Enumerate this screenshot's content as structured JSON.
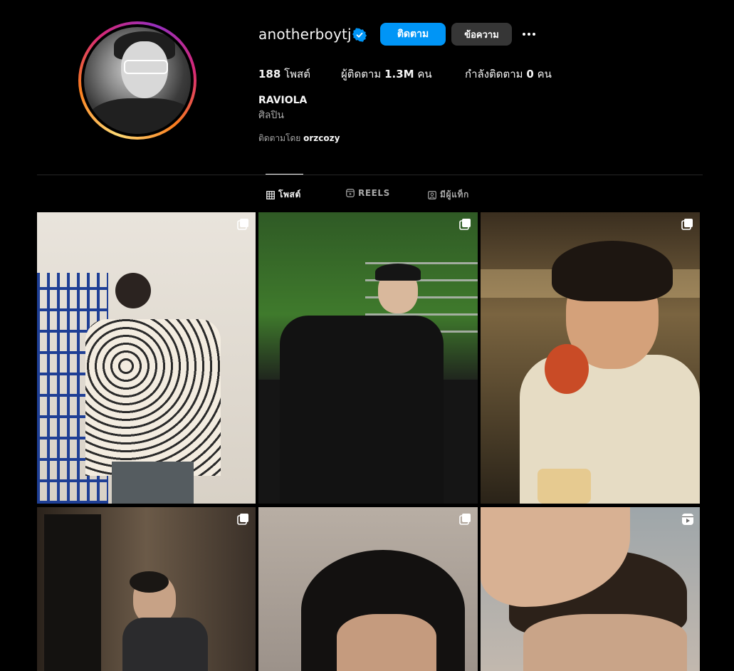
{
  "profile": {
    "username": "anotherboytj",
    "follow_label": "ติดตาม",
    "message_label": "ข้อความ",
    "posts_count": "188",
    "posts_label": "โพสต์",
    "followers_label": "ผู้ติดตาม",
    "followers_count": "1.3M",
    "followers_unit": "คน",
    "following_label": "กำลังติดตาม",
    "following_count": "0",
    "following_unit": "คน",
    "display_name": "RAVIOLA",
    "category": "ศิลปิน",
    "followed_by_label": "ติดตามโดย",
    "followed_by_user": "orzcozy"
  },
  "tabs": [
    {
      "label": "โพสต์",
      "icon": "grid-icon",
      "active": true
    },
    {
      "label": "REELS",
      "icon": "reels-icon",
      "active": false
    },
    {
      "label": "มีผู้แท็ก",
      "icon": "tagged-icon",
      "active": false
    }
  ],
  "posts": [
    {
      "type": "carousel",
      "icon": "carousel-icon"
    },
    {
      "type": "carousel",
      "icon": "carousel-icon"
    },
    {
      "type": "carousel",
      "icon": "carousel-icon"
    },
    {
      "type": "carousel",
      "icon": "carousel-icon"
    },
    {
      "type": "carousel",
      "icon": "carousel-icon"
    },
    {
      "type": "reel",
      "icon": "reel-icon"
    }
  ],
  "colors": {
    "background": "#000000",
    "follow_button": "#0095f6",
    "message_button": "#363636",
    "verified_badge": "#0095f6",
    "secondary_text": "#a8a8a8"
  }
}
